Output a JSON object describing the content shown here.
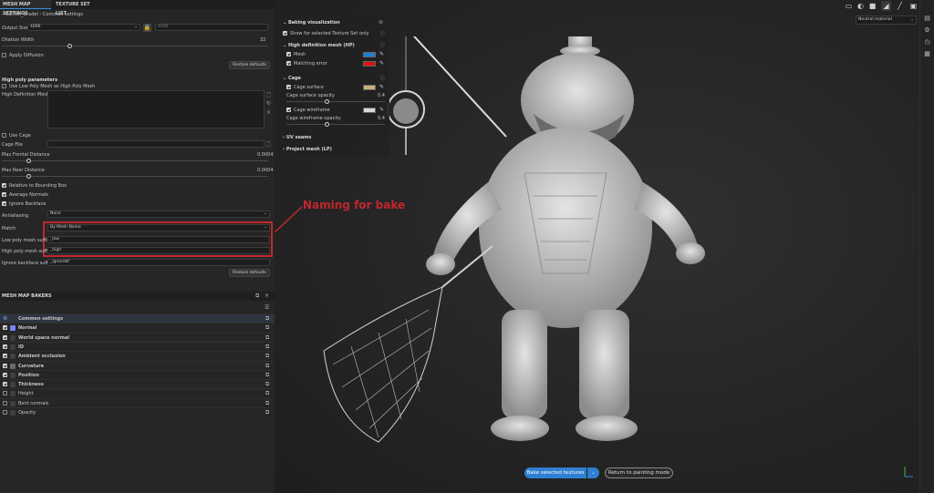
{
  "tabs": {
    "mesh_map_settings": "MESH MAP SETTINGS",
    "texture_set_list": "TEXTURE SET LIST"
  },
  "breadcrumb": {
    "project": "Catfish_Bradel",
    "section": "Common settings"
  },
  "common": {
    "output_size_label": "Output Size",
    "output_size_value": "4096",
    "output_size_linked": "4096",
    "dilation_label": "Dilation Width",
    "dilation_value": "32",
    "apply_diffusion": "Apply Diffusion",
    "restore_defaults": "Restore defaults"
  },
  "high_poly": {
    "title": "High poly parameters",
    "use_low_poly": "Use Low Poly Mesh as High Poly Mesh",
    "meshes_label": "High Definition Meshes",
    "use_cage": "Use Cage",
    "cage_file": "Cage File",
    "max_frontal_label": "Max Frontal Distance",
    "max_frontal_value": "0.0004",
    "max_rear_label": "Max Rear Distance",
    "max_rear_value": "0.0004",
    "relative_bbox": "Relative to Bounding Box",
    "average_normals": "Average Normals",
    "ignore_backface": "Ignore Backface",
    "antialiasing_label": "Antialiasing",
    "antialiasing_value": "None",
    "match_label": "Match",
    "match_value": "By Mesh Name",
    "low_suffix_label": "Low poly mesh suffix",
    "low_suffix_value": "_low",
    "high_suffix_label": "High poly mesh suffix",
    "high_suffix_value": "_high",
    "ignore_suffix_label": "Ignore backface suffix",
    "ignore_suffix_value": "_ignorebf",
    "restore_defaults": "Restore defaults"
  },
  "bakers": {
    "title": "MESH MAP BAKERS",
    "items": [
      {
        "label": "Common settings",
        "checked": null,
        "color": "#5aa0ff"
      },
      {
        "label": "Normal",
        "checked": true,
        "color": "#8080ff"
      },
      {
        "label": "World space normal",
        "checked": true,
        "color": "#3f3f3f"
      },
      {
        "label": "ID",
        "checked": true,
        "color": "#3f3f3f"
      },
      {
        "label": "Ambient occlusion",
        "checked": true,
        "color": "#3f3f3f"
      },
      {
        "label": "Curvature",
        "checked": true,
        "color": "#6b6b6b"
      },
      {
        "label": "Position",
        "checked": true,
        "color": "#3f3f3f"
      },
      {
        "label": "Thickness",
        "checked": true,
        "color": "#3f3f3f"
      },
      {
        "label": "Height",
        "checked": false,
        "color": "#3f3f3f"
      },
      {
        "label": "Bent normals",
        "checked": false,
        "color": "#3f3f3f"
      },
      {
        "label": "Opacity",
        "checked": false,
        "color": "#3f3f3f"
      }
    ]
  },
  "viz": {
    "title": "Baking visualization",
    "show_selected": "Show for selected Texture Set only",
    "hp_title": "High definition mesh (HP)",
    "mesh": "Mesh",
    "mesh_color": "#1f7fd0",
    "matching_error": "Matching error",
    "matching_color": "#e01010",
    "cage_title": "Cage",
    "cage_surface": "Cage surface",
    "cage_surface_color": "#c9b07a",
    "cage_surface_opacity": "Cage surface opacity",
    "cage_surface_opacity_value": "0.4",
    "cage_wireframe": "Cage wireframe",
    "cage_wireframe_color": "#d9d9d9",
    "cage_wireframe_opacity": "Cage wireframe opacity",
    "cage_wireframe_opacity_value": "0.4",
    "uv_seams": "UV seams",
    "project_mesh": "Project mesh (LP)"
  },
  "viewport": {
    "material": "Neutral material",
    "annotation": "Naming for bake",
    "annotation_color": "#c1272d",
    "bake_button": "Bake selected textures",
    "return_button": "Return to painting mode"
  }
}
